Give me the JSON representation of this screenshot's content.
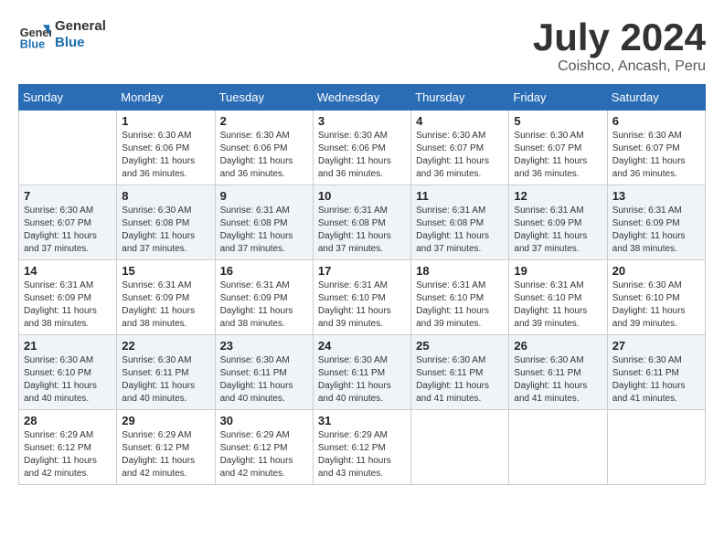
{
  "header": {
    "logo_general": "General",
    "logo_blue": "Blue",
    "month_title": "July 2024",
    "location": "Coishco, Ancash, Peru"
  },
  "weekdays": [
    "Sunday",
    "Monday",
    "Tuesday",
    "Wednesday",
    "Thursday",
    "Friday",
    "Saturday"
  ],
  "weeks": [
    [
      {
        "day": "",
        "sunrise": "",
        "sunset": "",
        "daylight": ""
      },
      {
        "day": "1",
        "sunrise": "6:30 AM",
        "sunset": "6:06 PM",
        "daylight": "11 hours and 36 minutes."
      },
      {
        "day": "2",
        "sunrise": "6:30 AM",
        "sunset": "6:06 PM",
        "daylight": "11 hours and 36 minutes."
      },
      {
        "day": "3",
        "sunrise": "6:30 AM",
        "sunset": "6:06 PM",
        "daylight": "11 hours and 36 minutes."
      },
      {
        "day": "4",
        "sunrise": "6:30 AM",
        "sunset": "6:07 PM",
        "daylight": "11 hours and 36 minutes."
      },
      {
        "day": "5",
        "sunrise": "6:30 AM",
        "sunset": "6:07 PM",
        "daylight": "11 hours and 36 minutes."
      },
      {
        "day": "6",
        "sunrise": "6:30 AM",
        "sunset": "6:07 PM",
        "daylight": "11 hours and 36 minutes."
      }
    ],
    [
      {
        "day": "7",
        "sunrise": "6:30 AM",
        "sunset": "6:07 PM",
        "daylight": "11 hours and 37 minutes."
      },
      {
        "day": "8",
        "sunrise": "6:30 AM",
        "sunset": "6:08 PM",
        "daylight": "11 hours and 37 minutes."
      },
      {
        "day": "9",
        "sunrise": "6:31 AM",
        "sunset": "6:08 PM",
        "daylight": "11 hours and 37 minutes."
      },
      {
        "day": "10",
        "sunrise": "6:31 AM",
        "sunset": "6:08 PM",
        "daylight": "11 hours and 37 minutes."
      },
      {
        "day": "11",
        "sunrise": "6:31 AM",
        "sunset": "6:08 PM",
        "daylight": "11 hours and 37 minutes."
      },
      {
        "day": "12",
        "sunrise": "6:31 AM",
        "sunset": "6:09 PM",
        "daylight": "11 hours and 37 minutes."
      },
      {
        "day": "13",
        "sunrise": "6:31 AM",
        "sunset": "6:09 PM",
        "daylight": "11 hours and 38 minutes."
      }
    ],
    [
      {
        "day": "14",
        "sunrise": "6:31 AM",
        "sunset": "6:09 PM",
        "daylight": "11 hours and 38 minutes."
      },
      {
        "day": "15",
        "sunrise": "6:31 AM",
        "sunset": "6:09 PM",
        "daylight": "11 hours and 38 minutes."
      },
      {
        "day": "16",
        "sunrise": "6:31 AM",
        "sunset": "6:09 PM",
        "daylight": "11 hours and 38 minutes."
      },
      {
        "day": "17",
        "sunrise": "6:31 AM",
        "sunset": "6:10 PM",
        "daylight": "11 hours and 39 minutes."
      },
      {
        "day": "18",
        "sunrise": "6:31 AM",
        "sunset": "6:10 PM",
        "daylight": "11 hours and 39 minutes."
      },
      {
        "day": "19",
        "sunrise": "6:31 AM",
        "sunset": "6:10 PM",
        "daylight": "11 hours and 39 minutes."
      },
      {
        "day": "20",
        "sunrise": "6:30 AM",
        "sunset": "6:10 PM",
        "daylight": "11 hours and 39 minutes."
      }
    ],
    [
      {
        "day": "21",
        "sunrise": "6:30 AM",
        "sunset": "6:10 PM",
        "daylight": "11 hours and 40 minutes."
      },
      {
        "day": "22",
        "sunrise": "6:30 AM",
        "sunset": "6:11 PM",
        "daylight": "11 hours and 40 minutes."
      },
      {
        "day": "23",
        "sunrise": "6:30 AM",
        "sunset": "6:11 PM",
        "daylight": "11 hours and 40 minutes."
      },
      {
        "day": "24",
        "sunrise": "6:30 AM",
        "sunset": "6:11 PM",
        "daylight": "11 hours and 40 minutes."
      },
      {
        "day": "25",
        "sunrise": "6:30 AM",
        "sunset": "6:11 PM",
        "daylight": "11 hours and 41 minutes."
      },
      {
        "day": "26",
        "sunrise": "6:30 AM",
        "sunset": "6:11 PM",
        "daylight": "11 hours and 41 minutes."
      },
      {
        "day": "27",
        "sunrise": "6:30 AM",
        "sunset": "6:11 PM",
        "daylight": "11 hours and 41 minutes."
      }
    ],
    [
      {
        "day": "28",
        "sunrise": "6:29 AM",
        "sunset": "6:12 PM",
        "daylight": "11 hours and 42 minutes."
      },
      {
        "day": "29",
        "sunrise": "6:29 AM",
        "sunset": "6:12 PM",
        "daylight": "11 hours and 42 minutes."
      },
      {
        "day": "30",
        "sunrise": "6:29 AM",
        "sunset": "6:12 PM",
        "daylight": "11 hours and 42 minutes."
      },
      {
        "day": "31",
        "sunrise": "6:29 AM",
        "sunset": "6:12 PM",
        "daylight": "11 hours and 43 minutes."
      },
      {
        "day": "",
        "sunrise": "",
        "sunset": "",
        "daylight": ""
      },
      {
        "day": "",
        "sunrise": "",
        "sunset": "",
        "daylight": ""
      },
      {
        "day": "",
        "sunrise": "",
        "sunset": "",
        "daylight": ""
      }
    ]
  ]
}
